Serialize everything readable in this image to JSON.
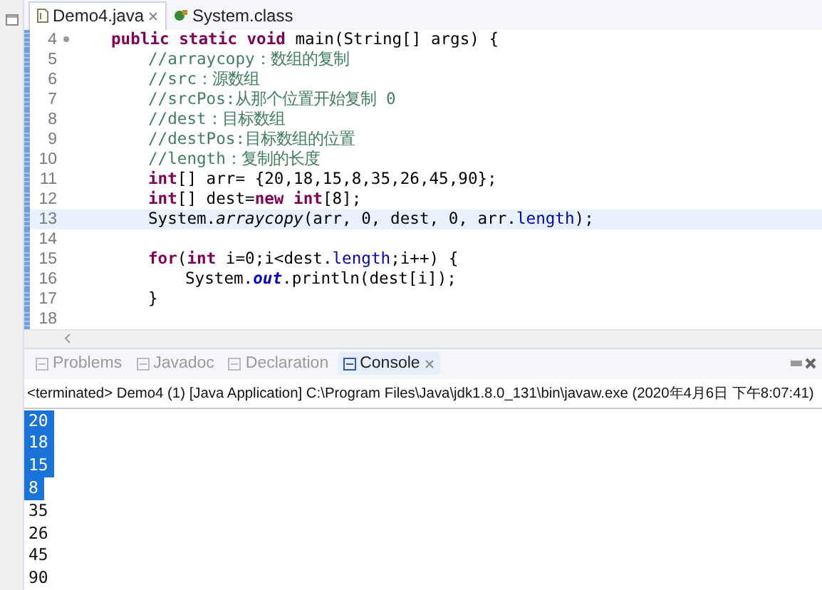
{
  "editor_tabs": [
    {
      "label": "Demo4.java",
      "selected": true,
      "closable": true
    },
    {
      "label": "System.class",
      "selected": false,
      "closable": false
    }
  ],
  "code_lines": [
    {
      "number": "4",
      "current": false,
      "folding": true,
      "segments": [
        {
          "text": "public static void ",
          "kind": "keyword"
        },
        {
          "text": "main(String[] args) {",
          "kind": "plain"
        }
      ],
      "children": [
        {
          "number": "5",
          "current": false,
          "folding": false,
          "segments": [
            {
              "text": "//arraycopy：数组的复制",
              "kind": "comment"
            }
          ]
        },
        {
          "number": "6",
          "current": false,
          "folding": false,
          "segments": [
            {
              "text": "//src：源数组",
              "kind": "comment"
            }
          ]
        },
        {
          "number": "7",
          "current": false,
          "folding": false,
          "segments": [
            {
              "text": "//srcPos:从那个位置开始复制 0",
              "kind": "comment"
            }
          ]
        },
        {
          "number": "8",
          "current": false,
          "folding": false,
          "segments": [
            {
              "text": "//dest：目标数组",
              "kind": "comment"
            }
          ]
        },
        {
          "number": "9",
          "current": false,
          "folding": false,
          "segments": [
            {
              "text": "//destPos:目标数组的位置",
              "kind": "comment"
            }
          ]
        },
        {
          "number": "10",
          "current": false,
          "folding": false,
          "segments": [
            {
              "text": "//length：复制的长度",
              "kind": "comment"
            }
          ]
        },
        {
          "number": "11",
          "current": false,
          "folding": false,
          "segments": [
            {
              "text": "int",
              "kind": "keyword"
            },
            {
              "text": "[] arr= {20,18,15,8,35,26,45,90};",
              "kind": "plain"
            }
          ]
        },
        {
          "number": "12",
          "current": false,
          "folding": false,
          "segments": [
            {
              "text": "int",
              "kind": "keyword"
            },
            {
              "text": "[] dest=",
              "kind": "plain"
            },
            {
              "text": "new int",
              "kind": "keyword"
            },
            {
              "text": "[8];",
              "kind": "plain"
            }
          ]
        },
        {
          "number": "13",
          "current": true,
          "folding": false,
          "segments": [
            {
              "text": "System.",
              "kind": "plain"
            },
            {
              "text": "arraycopy",
              "kind": "static"
            },
            {
              "text": "(arr, 0, dest, 0, arr.",
              "kind": "plain"
            },
            {
              "text": "length",
              "kind": "field"
            },
            {
              "text": ");",
              "kind": "plain"
            }
          ]
        },
        {
          "number": "14",
          "current": false,
          "folding": false
        },
        {
          "number": "15",
          "current": false,
          "folding": false,
          "segments": [
            {
              "text": "for",
              "kind": "keyword"
            },
            {
              "text": "(",
              "kind": "plain"
            },
            {
              "text": "int",
              "kind": "keyword"
            },
            {
              "text": " i=0;i<dest.",
              "kind": "plain"
            },
            {
              "text": "length",
              "kind": "field"
            },
            {
              "text": ";i++) {",
              "kind": "plain"
            }
          ],
          "children": [
            {
              "number": "16",
              "current": false,
              "folding": false,
              "segments": [
                {
                  "text": "System.",
                  "kind": "plain"
                },
                {
                  "text": "out",
                  "kind": "staticfield"
                },
                {
                  "text": ".println(dest[i]);",
                  "kind": "plain"
                }
              ]
            }
          ]
        },
        {
          "number": "17",
          "current": false,
          "folding": false,
          "segments": [
            {
              "text": "}",
              "kind": "plain"
            }
          ]
        },
        {
          "number": "18",
          "current": false,
          "folding": false
        }
      ]
    }
  ],
  "view_tabs": [
    {
      "label": "Problems",
      "selected": false,
      "closable": false
    },
    {
      "label": "Javadoc",
      "selected": false,
      "closable": false
    },
    {
      "label": "Declaration",
      "selected": false,
      "closable": false
    },
    {
      "label": "Console",
      "selected": true,
      "closable": true
    }
  ],
  "console": {
    "status": "<terminated> Demo4 (1) [Java Application] C:\\Program Files\\Java\\jdk1.8.0_131\\bin\\javaw.exe (2020年4月6日 下午8:07:41)",
    "output": [
      {
        "text": "20",
        "selected": true
      },
      {
        "text": "18",
        "selected": true
      },
      {
        "text": "15",
        "selected": true
      },
      {
        "text": "8",
        "selected": true
      },
      {
        "text": "35",
        "selected": false
      },
      {
        "text": "26",
        "selected": false
      },
      {
        "text": "45",
        "selected": false
      },
      {
        "text": "90",
        "selected": false
      }
    ]
  }
}
